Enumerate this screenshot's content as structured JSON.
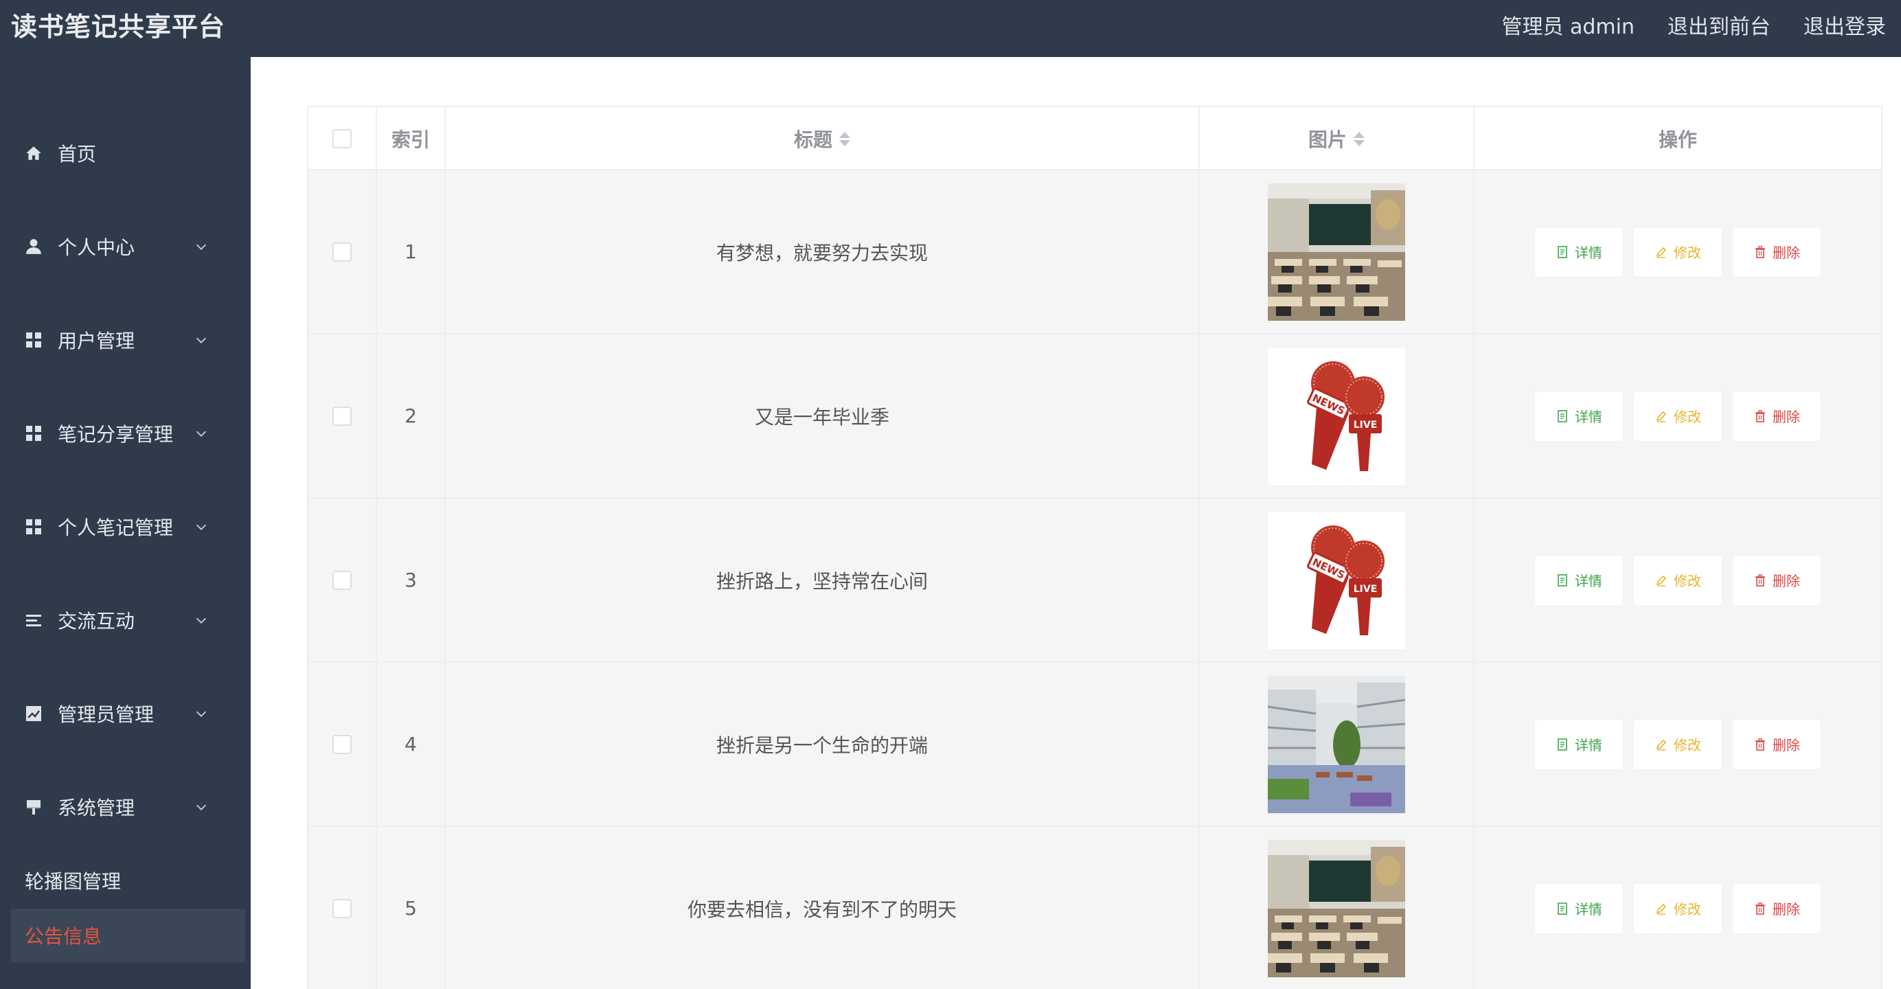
{
  "header": {
    "title": "读书笔记共享平台",
    "user": "管理员 admin",
    "to_front": "退出到前台",
    "logout": "退出登录"
  },
  "sidebar": {
    "items": [
      {
        "label": "首页",
        "icon": "home-icon"
      },
      {
        "label": "个人中心",
        "icon": "user-icon"
      },
      {
        "label": "用户管理",
        "icon": "grid-icon"
      },
      {
        "label": "笔记分享管理",
        "icon": "grid-icon"
      },
      {
        "label": "个人笔记管理",
        "icon": "grid-icon"
      },
      {
        "label": "交流互动",
        "icon": "list-icon"
      },
      {
        "label": "管理员管理",
        "icon": "chart-icon"
      },
      {
        "label": "系统管理",
        "icon": "paint-icon"
      }
    ],
    "sub_items": [
      {
        "label": "轮播图管理",
        "active": false
      },
      {
        "label": "公告信息",
        "active": true
      }
    ],
    "active_color": "#e5543f"
  },
  "table": {
    "columns": [
      "索引",
      "标题",
      "图片",
      "操作"
    ],
    "rows": [
      {
        "index": "1",
        "title": "有梦想，就要努力去实现",
        "image": "classroom"
      },
      {
        "index": "2",
        "title": "又是一年毕业季",
        "image": "news-microphones"
      },
      {
        "index": "3",
        "title": "挫折路上，坚持常在心间",
        "image": "news-microphones"
      },
      {
        "index": "4",
        "title": "挫折是另一个生命的开端",
        "image": "school-courtyard"
      },
      {
        "index": "5",
        "title": "你要去相信，没有到不了的明天",
        "image": "classroom"
      }
    ],
    "actions": {
      "detail": "详情",
      "edit": "修改",
      "delete": "删除"
    }
  },
  "colors": {
    "header_bg": "#2f3b4b",
    "detail": "#3ca64a",
    "edit": "#e6b52f",
    "delete": "#e04646"
  }
}
